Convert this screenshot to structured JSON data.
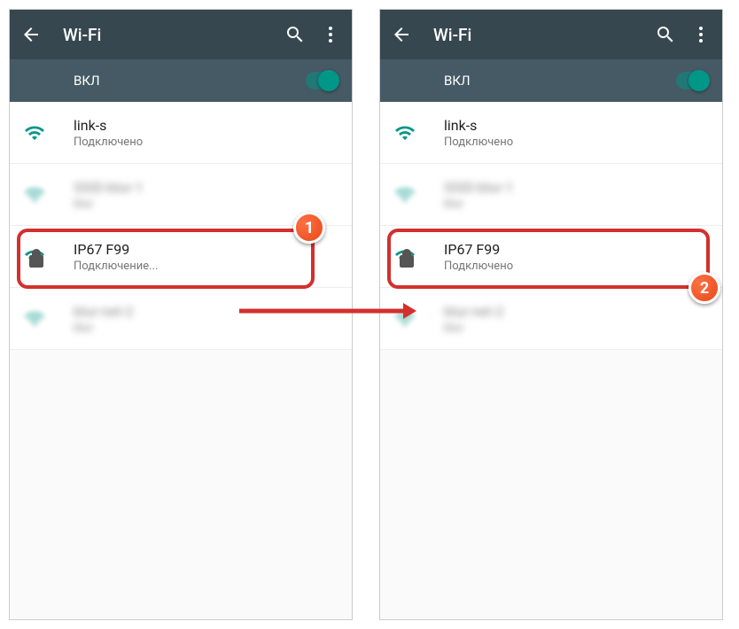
{
  "colors": {
    "teal": "#009688",
    "appbar": "#37474f",
    "sub": "#455a64",
    "highlight": "#d32f2f"
  },
  "left": {
    "title": "Wi‑Fi",
    "toggle_label": "ВКЛ",
    "networks": [
      {
        "name": "link-s",
        "status": "Подключено",
        "secured": false,
        "blurred": false
      },
      {
        "name": "SSID-blur-1",
        "status": "blur",
        "secured": true,
        "blurred": true
      },
      {
        "name": "IP67 F99",
        "status": "Подключение...",
        "secured": true,
        "blurred": false,
        "highlighted": true
      },
      {
        "name": "blur-net-2",
        "status": "blur",
        "secured": false,
        "blurred": true
      }
    ]
  },
  "right": {
    "title": "Wi‑Fi",
    "toggle_label": "ВКЛ",
    "networks": [
      {
        "name": "link-s",
        "status": "Подключено",
        "secured": false,
        "blurred": false
      },
      {
        "name": "SSID-blur-1",
        "status": "blur",
        "secured": true,
        "blurred": true
      },
      {
        "name": "IP67 F99",
        "status": "Подключено",
        "secured": true,
        "blurred": false,
        "highlighted": true
      },
      {
        "name": "blur-net-2",
        "status": "blur",
        "secured": false,
        "blurred": true
      }
    ]
  },
  "badges": {
    "left": "1",
    "right": "2"
  }
}
